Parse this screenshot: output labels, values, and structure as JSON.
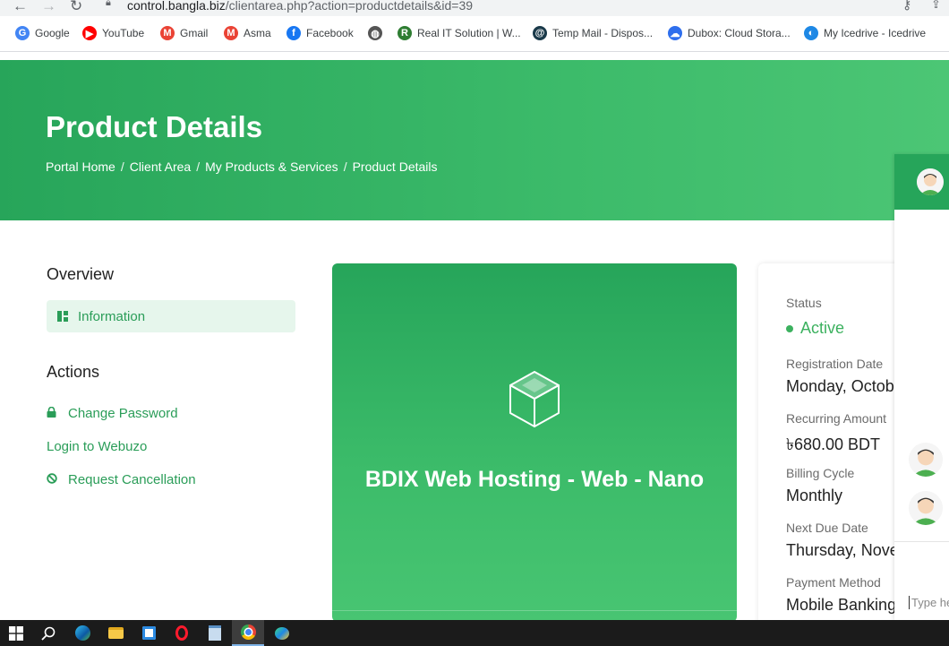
{
  "browser": {
    "url_host": "control.bangla.biz",
    "url_path": "/clientarea.php?action=productdetails&id=39",
    "bookmarks": [
      {
        "label": "Google",
        "icon": "google-icon",
        "icon_text": "G",
        "color": "#4285f4"
      },
      {
        "label": "YouTube",
        "icon": "youtube-icon",
        "icon_text": "▶",
        "color": "#ff0000"
      },
      {
        "label": "Gmail",
        "icon": "gmail-icon",
        "icon_text": "M",
        "color": "#ea4335"
      },
      {
        "label": "Asma",
        "icon": "gmail-icon",
        "icon_text": "M",
        "color": "#ea4335"
      },
      {
        "label": "Facebook",
        "icon": "facebook-icon",
        "icon_text": "f",
        "color": "#1877f2"
      },
      {
        "label": "",
        "icon": "globe-icon",
        "icon_text": "◍",
        "color": "#555555"
      },
      {
        "label": "Real IT Solution | W...",
        "icon": "realit-icon",
        "icon_text": "R",
        "color": "#2e7d32"
      },
      {
        "label": "Temp Mail - Dispos...",
        "icon": "tempmail-icon",
        "icon_text": "@",
        "color": "#1a3a4a"
      },
      {
        "label": "Dubox: Cloud Stora...",
        "icon": "cloud-icon",
        "icon_text": "☁",
        "color": "#2f6fed"
      },
      {
        "label": "My Icedrive - Icedrive",
        "icon": "icedrive-icon",
        "icon_text": "◐",
        "color": "#1e88e5"
      }
    ]
  },
  "hero": {
    "title": "Product Details",
    "breadcrumb": [
      "Portal Home",
      "Client Area",
      "My Products & Services",
      "Product Details"
    ]
  },
  "sidebar": {
    "overview_heading": "Overview",
    "overview_item": "Information",
    "actions_heading": "Actions",
    "actions": [
      "Change Password",
      "Login to Webuzo",
      "Request Cancellation"
    ]
  },
  "product": {
    "name": "BDIX Web Hosting - Web - Nano"
  },
  "details": {
    "status_label": "Status",
    "status_value": "Active",
    "registration_label": "Registration Date",
    "registration_value": "Monday, Octob",
    "recurring_label": "Recurring Amount",
    "recurring_value": "৳680.00 BDT",
    "billing_label": "Billing Cycle",
    "billing_value": "Monthly",
    "next_due_label": "Next Due Date",
    "next_due_value": "Thursday, Nove",
    "payment_label": "Payment Method",
    "payment_value": "Mobile Banking"
  },
  "chat": {
    "input_placeholder": "Type he"
  },
  "colors": {
    "brand_green": "#2a9d58",
    "hero_green": "#3cbb6a",
    "active_green": "#3cb15f"
  }
}
